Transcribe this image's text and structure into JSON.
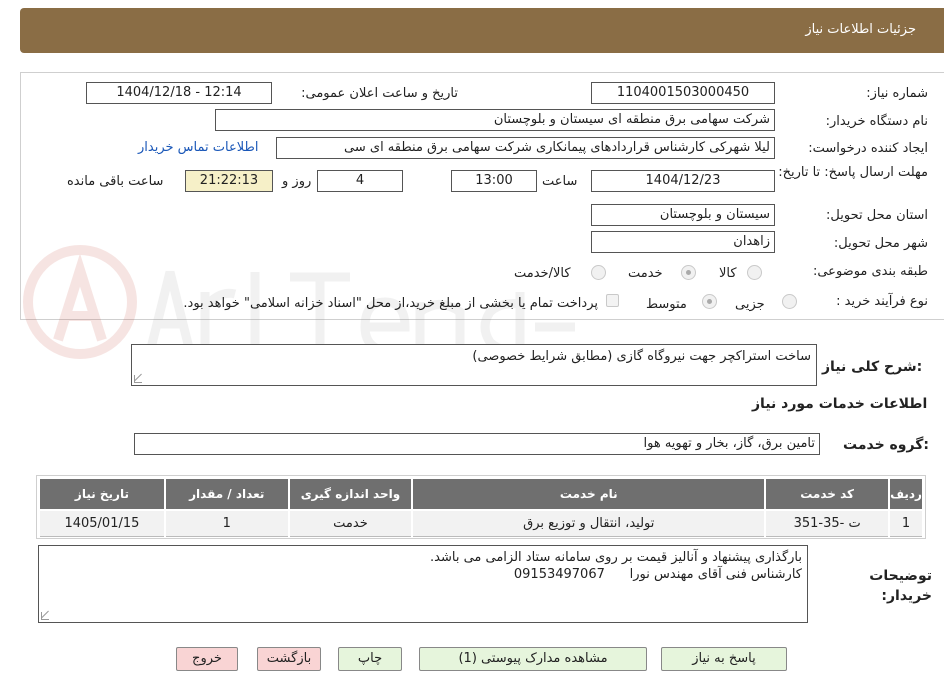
{
  "header": {
    "title": "جزئیات اطلاعات نیاز"
  },
  "need_number": {
    "label": "شماره نیاز:",
    "value": "1104001503000450"
  },
  "announce_datetime": {
    "label": "تاریخ و ساعت اعلان عمومی:",
    "value": "1404/12/18 - 12:14"
  },
  "buyer_org": {
    "label": "نام دستگاه خریدار:",
    "value": "شرکت سهامی برق منطقه ای سیستان و بلوچستان"
  },
  "requester": {
    "label": "ایجاد کننده درخواست:",
    "value": "لیلا شهرکی کارشناس قراردادهای پیمانکاری شرکت سهامی برق منطقه ای سی",
    "contact_link": "اطلاعات تماس خریدار"
  },
  "deadline": {
    "label": "مهلت ارسال پاسخ: تا تاریخ:",
    "date": "1404/12/23",
    "time_label": "ساعت",
    "time": "13:00",
    "days": "4",
    "days_label": "روز و",
    "remaining": "21:22:13",
    "remaining_label": "ساعت باقی مانده"
  },
  "delivery_province": {
    "label": "استان محل تحویل:",
    "value": "سیستان و بلوچستان"
  },
  "delivery_city": {
    "label": "شهر محل تحویل:",
    "value": "زاهدان"
  },
  "category": {
    "label": "طبقه بندی موضوعی:",
    "options": [
      "کالا",
      "خدمت",
      "کالا/خدمت"
    ],
    "selected": "خدمت"
  },
  "process_type": {
    "label": "نوع فرآیند خرید :",
    "options": [
      "جزیی",
      "متوسط"
    ],
    "selected": "متوسط",
    "payment_note": "پرداخت تمام یا بخشی از مبلغ خرید،از محل \"اسناد خزانه اسلامی\" خواهد بود."
  },
  "general_description": {
    "label": "شرح کلی نیاز:",
    "value": "ساخت استراکچر جهت نیروگاه گازی (مطابق شرایط خصوصی)"
  },
  "services_section": {
    "title": "اطلاعات خدمات مورد نیاز"
  },
  "service_group": {
    "label": "گروه خدمت:",
    "value": "تامین برق، گاز، بخار و تهویه هوا"
  },
  "table": {
    "headers": [
      "ردیف",
      "کد خدمت",
      "نام خدمت",
      "واحد اندازه گیری",
      "تعداد / مقدار",
      "تاریخ نیاز"
    ],
    "rows": [
      [
        "1",
        "ت -35-351",
        "تولید، انتقال و توزیع برق",
        "خدمت",
        "1",
        "1405/01/15"
      ]
    ]
  },
  "buyer_notes": {
    "label": "توضیحات خریدار:",
    "line1": "بارگذاری پیشنهاد و آنالیز قیمت بر روی سامانه ستاد الزامی می باشد.",
    "line2": "کارشناس فنی آقای مهندس نورا      09153497067"
  },
  "buttons": {
    "reply": "پاسخ به نیاز",
    "attachments": "مشاهده مدارک پیوستی (1)",
    "print": "چاپ",
    "back": "بازگشت",
    "exit": "خروج"
  },
  "colors": {
    "header_bg": "#8a6d45",
    "green_btn": "#e6f5dc",
    "pink_btn": "#f9d4d4",
    "table_header": "#6f6f6f"
  }
}
